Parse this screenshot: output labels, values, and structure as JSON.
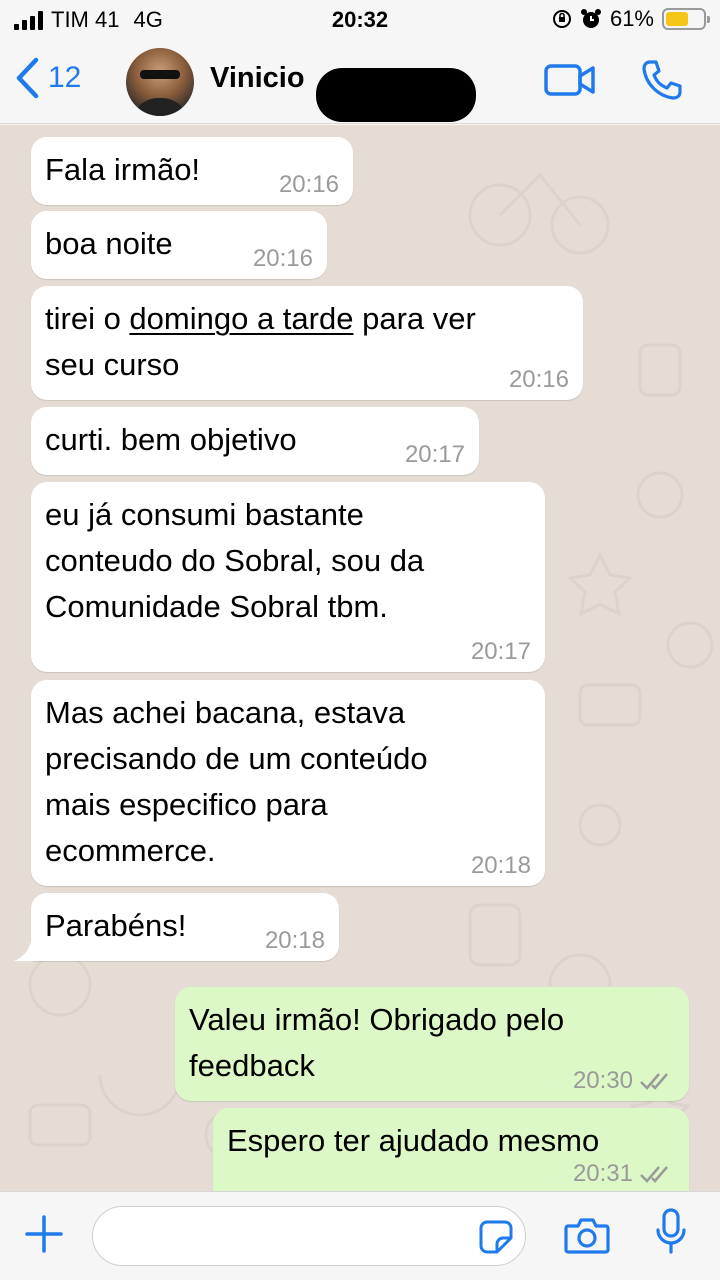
{
  "status_bar": {
    "carrier": "TIM 41",
    "network": "4G",
    "time": "20:32",
    "battery": "61%",
    "battery_level": 0.61
  },
  "header": {
    "back_count": "12",
    "contact_name": "Vinicio"
  },
  "messages": [
    {
      "dir": "in",
      "text": "Fala irmão!",
      "time": "20:16"
    },
    {
      "dir": "in",
      "text": "boa noite",
      "time": "20:16"
    },
    {
      "dir": "in",
      "text_pre": "tirei o ",
      "text_link": "domingo a tarde",
      "text_post": " para ver\nseu curso",
      "time": "20:16"
    },
    {
      "dir": "in",
      "text": "curti. bem objetivo",
      "time": "20:17"
    },
    {
      "dir": "in",
      "text": "eu já consumi bastante\nconteudo do Sobral, sou da\nComunidade Sobral tbm.",
      "time": "20:17"
    },
    {
      "dir": "in",
      "text": "Mas achei bacana, estava\nprecisando de um conteúdo\nmais especifico para\necommerce.",
      "time": "20:18"
    },
    {
      "dir": "in",
      "text": "Parabéns!",
      "time": "20:18"
    },
    {
      "dir": "out",
      "text": "Valeu irmão! Obrigado pelo\nfeedback",
      "time": "20:30"
    },
    {
      "dir": "out",
      "text": "Espero ter ajudado mesmo",
      "time": "20:31"
    }
  ],
  "colors": {
    "accent": "#1f7aec",
    "incoming_bubble": "#ffffff",
    "outgoing_bubble": "#dcf8c6",
    "chat_background": "#e5ddd5"
  },
  "icons": {
    "back": "chevron-left-icon",
    "video": "video-call-icon",
    "phone": "phone-call-icon",
    "attach": "plus-icon",
    "sticker": "sticker-icon",
    "camera": "camera-icon",
    "mic": "microphone-icon",
    "read": "double-check-icon"
  }
}
